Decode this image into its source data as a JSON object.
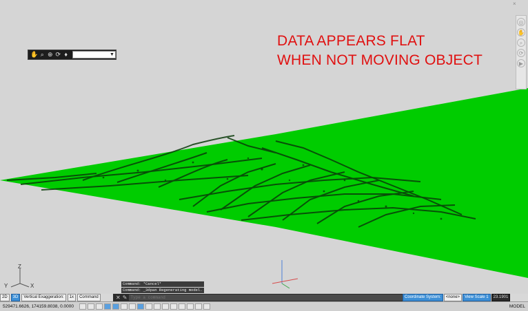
{
  "annotation": {
    "line1": "DATA APPEARS FLAT",
    "line2": "WHEN NOT MOVING OBJECT",
    "color": "#e01010"
  },
  "canvas": {
    "background": "#d5d5d5",
    "surface_color": "#00cc00"
  },
  "nav_toolbar": {
    "icons": [
      "pan-icon",
      "zoom-icon",
      "zoom-window-icon",
      "orbit-icon",
      "walk-icon"
    ],
    "view_select_value": ""
  },
  "navbar": {
    "close_glyph": "×",
    "buttons": [
      "steering-wheel-icon",
      "pan-icon",
      "zoom-icon",
      "orbit-icon",
      "showmotion-icon"
    ]
  },
  "ucs": {
    "z": "Z",
    "y": "Y",
    "x": "X"
  },
  "command": {
    "history": [
      "Command: *Cancel*",
      "Command: _3dpan Regenerating model."
    ],
    "placeholder": "Type a command",
    "close_glyph": "✕",
    "wrench_glyph": "✎"
  },
  "ribbon_strip": {
    "view_2d": "2D",
    "view_3d": "3D",
    "vertical_exaggeration_label": "Vertical Exaggeration:",
    "vertical_exaggeration_value": "1x",
    "command_tab": "Command"
  },
  "right_strip": {
    "coord_label": "Coordinate System:",
    "coord_value": "<none>",
    "view_scale_label": "View Scale 1",
    "view_scale_value": "23.1901"
  },
  "statusbar": {
    "coordinates": "529471.6626, 174159.8038, 0.0000",
    "model_label": "MODEL",
    "icons": [
      "snap-icon",
      "grid-icon",
      "ortho-icon",
      "polar-icon",
      "osnap-icon",
      "otrack-icon",
      "ducs-icon",
      "dyn-icon",
      "lwt-icon",
      "tpy-icon",
      "qp-icon",
      "sc-icon",
      "am-icon",
      "model-icon",
      "layout-icon",
      "annotation-icon"
    ]
  }
}
